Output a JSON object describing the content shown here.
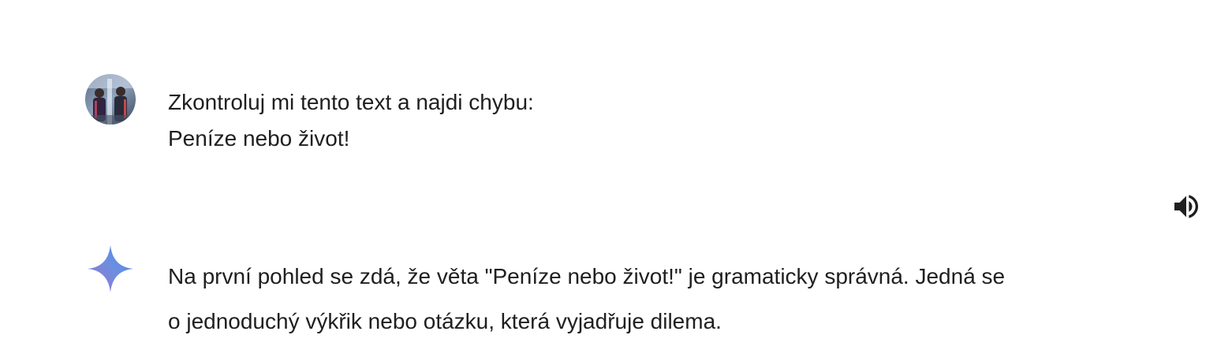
{
  "user_message": {
    "avatar_icon": "user-avatar-photo",
    "lines": [
      "Zkontroluj mi tento text a najdi chybu:",
      "Peníze nebo život!"
    ]
  },
  "toolbar": {
    "speaker_icon": "volume-up-icon"
  },
  "model_response": {
    "icon": "gemini-sparkle-icon",
    "lines": [
      "Na první pohled se zdá, že věta \"Peníze nebo život!\" je gramaticky správná. Jedná se",
      "o jednoduchý výkřik nebo otázku, která vyjadřuje dilema."
    ]
  },
  "colors": {
    "text": "#1f1f1f",
    "background": "#ffffff",
    "sparkle_start": "#9b72cb",
    "sparkle_end": "#4285f4"
  }
}
